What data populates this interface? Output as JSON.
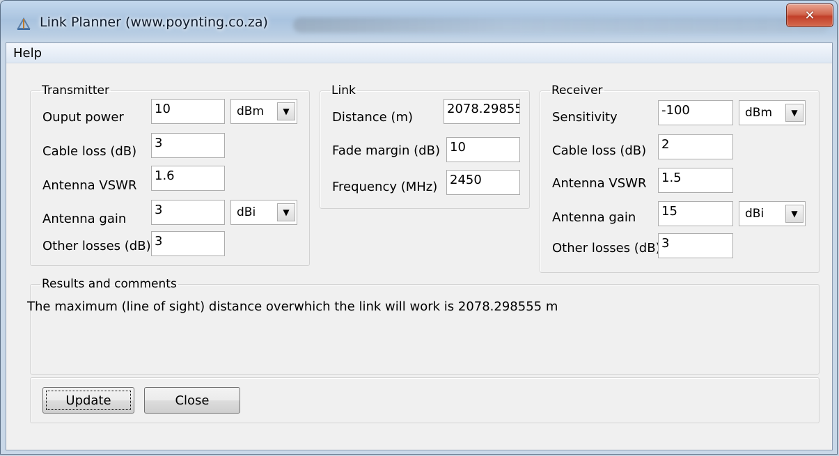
{
  "window": {
    "title": "Link Planner (www.poynting.co.za)",
    "close_glyph": "✕"
  },
  "menu": {
    "help": "Help"
  },
  "transmitter": {
    "legend": "Transmitter",
    "output_power_label": "Ouput power",
    "output_power_value": "10",
    "output_power_unit": "dBm",
    "cable_loss_label": "Cable loss (dB)",
    "cable_loss_value": "3",
    "vswr_label": "Antenna VSWR",
    "vswr_value": "1.6",
    "gain_label": "Antenna gain",
    "gain_value": "3",
    "gain_unit": "dBi",
    "other_losses_label": "Other losses (dB)",
    "other_losses_value": "3"
  },
  "link": {
    "legend": "Link",
    "distance_label": "Distance (m)",
    "distance_value": "2078.29855",
    "fade_margin_label": "Fade margin (dB)",
    "fade_margin_value": "10",
    "frequency_label": "Frequency (MHz)",
    "frequency_value": "2450"
  },
  "receiver": {
    "legend": "Receiver",
    "sensitivity_label": "Sensitivity",
    "sensitivity_value": "-100",
    "sensitivity_unit": "dBm",
    "cable_loss_label": "Cable loss (dB)",
    "cable_loss_value": "2",
    "vswr_label": "Antenna VSWR",
    "vswr_value": "1.5",
    "gain_label": "Antenna gain",
    "gain_value": "15",
    "gain_unit": "dBi",
    "other_losses_label": "Other losses (dB)",
    "other_losses_value": "3"
  },
  "results": {
    "legend": "Results and comments",
    "text": "The maximum (line of sight) distance overwhich the link will work is 2078.298555 m"
  },
  "buttons": {
    "update": "Update",
    "close": "Close"
  },
  "icons": {
    "dropdown": "▼",
    "app": "app-icon"
  }
}
